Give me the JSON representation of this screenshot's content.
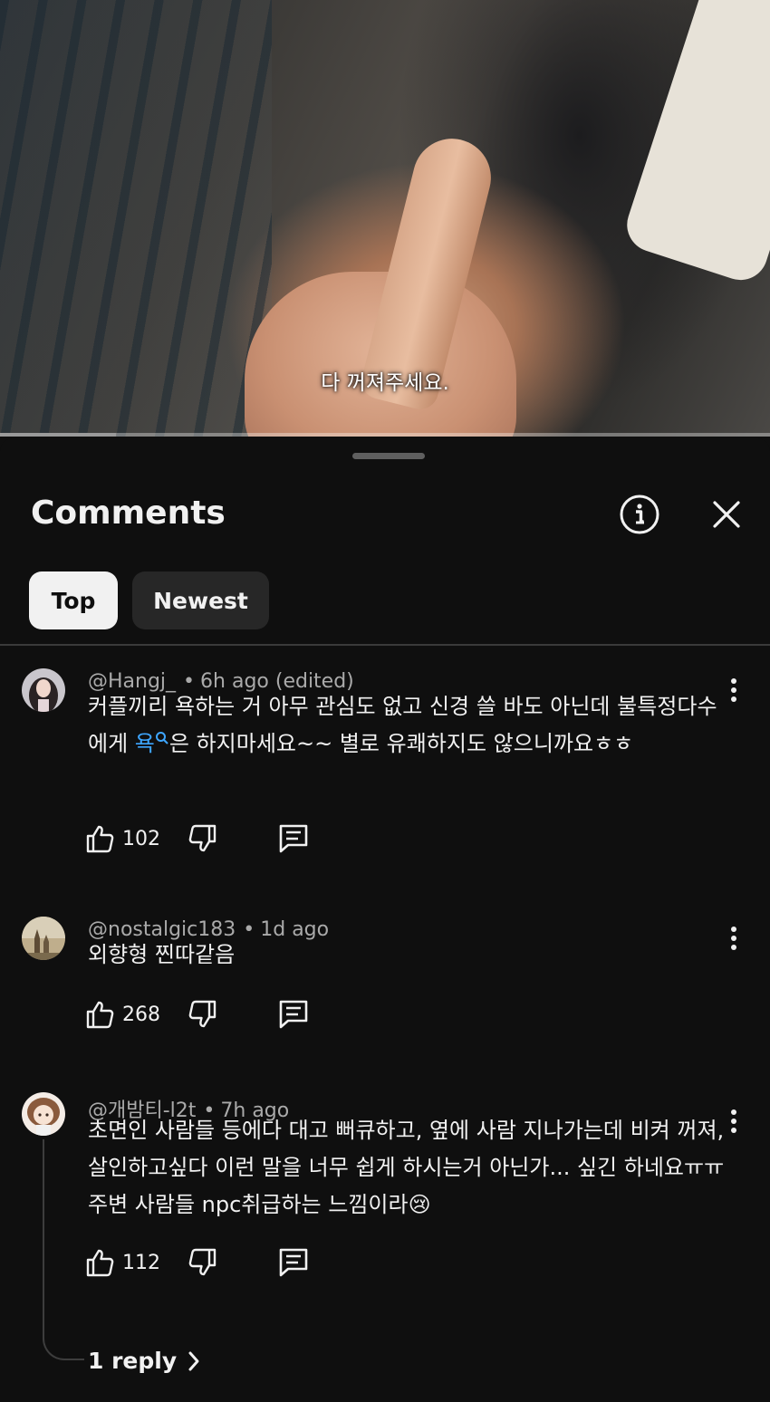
{
  "video": {
    "subtitle": "다 꺼져주세요.",
    "progress_fraction": 0.15
  },
  "sheet": {
    "title": "Comments",
    "info_icon": "info-circle-icon",
    "close_icon": "close-icon",
    "chips": [
      {
        "label": "Top",
        "selected": true
      },
      {
        "label": "Newest",
        "selected": false
      }
    ]
  },
  "comments": [
    {
      "author": "@Hangj_",
      "time": "6h ago (edited)",
      "text_before": "커플끼리 욕하는 거 아무 관심도 없고 신경 쓸 바도 아닌데 불특정다수에게 ",
      "link_text": "욕",
      "text_after": "은 하지마세요~~ 별로 유쾌하지도 않으니까요ㅎㅎ",
      "likes": "102"
    },
    {
      "author": "@nostalgic183",
      "time": "1d ago",
      "text": "외향형 찐따같음",
      "likes": "268"
    },
    {
      "author": "@개밤티-l2t",
      "time": "7h ago",
      "text": "초면인 사람들 등에다 대고 뻐큐하고, 옆에 사람 지나가는데 비켜 꺼져, 살인하고싶다 이런 말을 너무 쉽게 하시는거 아닌가... 싶긴 하네요ㅠㅠ 주변 사람들 npc취급하는 느낌이라",
      "emoji": "😢",
      "likes": "112",
      "replies_label": "1 reply"
    }
  ],
  "colors": {
    "background": "#0f0f0f",
    "text": "#f1f1f1",
    "secondary": "#aaaaaa",
    "link": "#3ea6ff",
    "chip_selected": "#f1f1f1",
    "chip": "#272727"
  }
}
